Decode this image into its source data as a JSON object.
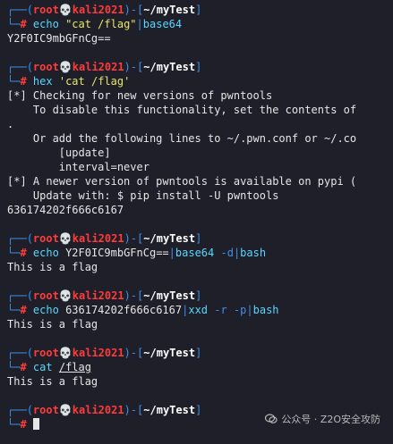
{
  "prompt": {
    "frame_top": "┌──",
    "frame_bottom": "└─",
    "user": "root",
    "skull": "💀",
    "host": "kali2021",
    "path": "~/myTest",
    "symbol": "#"
  },
  "blocks": [
    {
      "cmd": "echo",
      "arg": "\"cat /flag\"",
      "pipe": "|",
      "cmd2": "base64",
      "output": [
        "Y2F0IC9mbGFnCg=="
      ]
    },
    {
      "cmd": "hex",
      "arg": "'cat /flag'",
      "output": [
        "[*] Checking for new versions of pwntools",
        "    To disable this functionality, set the contents of",
        ".",
        "    Or add the following lines to ~/.pwn.conf or ~/.co",
        "        [update]",
        "        interval=never",
        "[*] A newer version of pwntools is available on pypi (",
        "    Update with: $ pip install -U pwntools",
        "636174202f666c6167"
      ]
    },
    {
      "cmd": "echo",
      "arg": "Y2F0IC9mbGFnCg==",
      "pipe": "|",
      "cmd2": "base64",
      "arg2": "-d",
      "pipe2": "|",
      "cmd3": "bash",
      "output": [
        "This is a flag"
      ]
    },
    {
      "cmd": "echo",
      "arg": "636174202f666c6167",
      "pipe": "|",
      "cmd2": "xxd",
      "arg2": "-r -p",
      "pipe2": "|",
      "cmd3": "bash",
      "output": [
        "This is a flag"
      ]
    },
    {
      "cmd": "cat",
      "arg": "/flag",
      "output": [
        "This is a flag"
      ]
    }
  ],
  "watermark": "公众号 · Z2O安全攻防"
}
